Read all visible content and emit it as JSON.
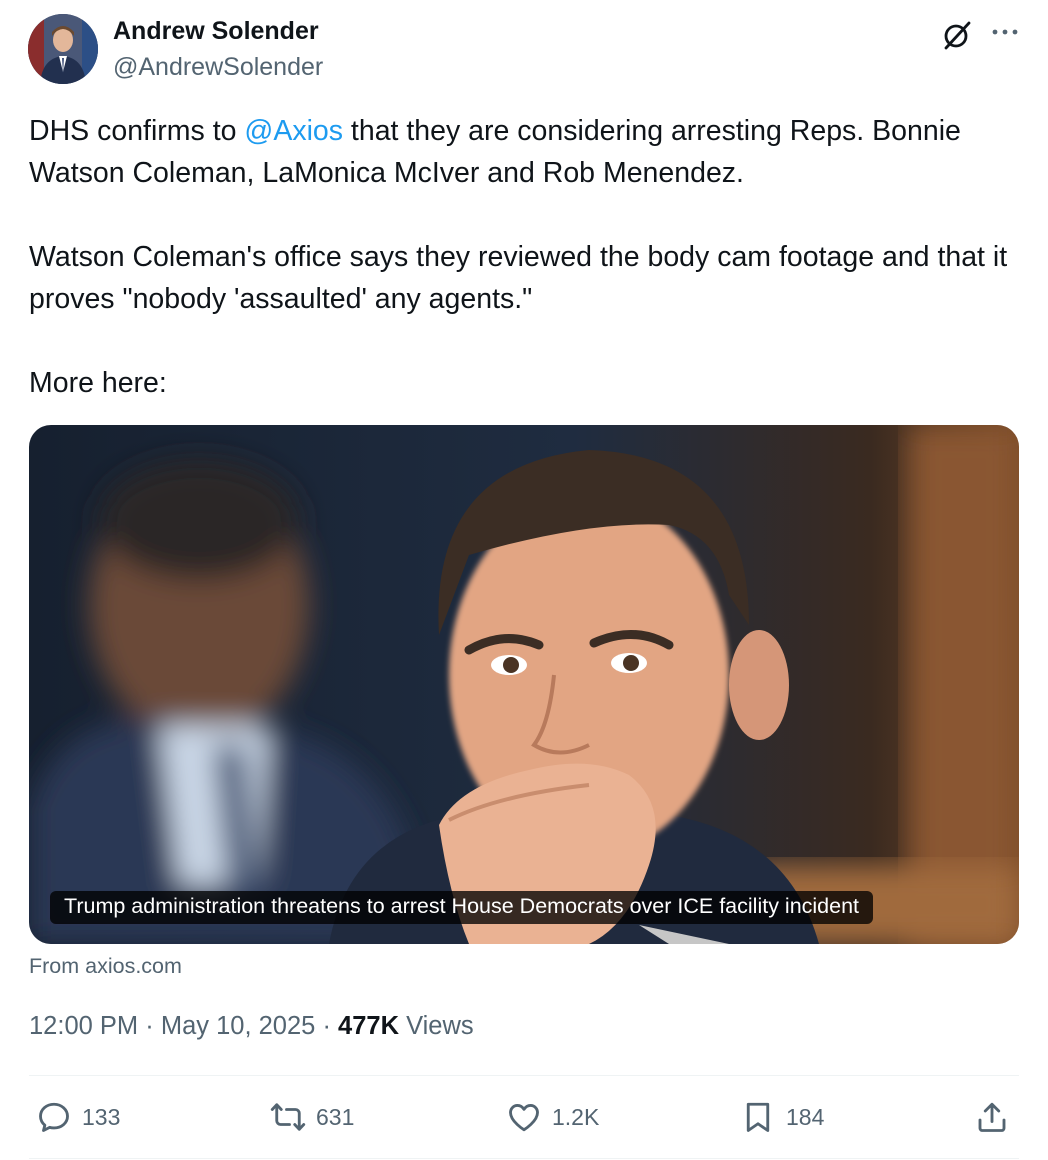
{
  "author": {
    "name": "Andrew Solender",
    "handle": "@AndrewSolender"
  },
  "tweet": {
    "line1_before": "DHS confirms to ",
    "mention": "@Axios",
    "line1_after": " that they are considering arresting Reps. Bonnie Watson Coleman, LaMonica McIver and Rob Menendez.",
    "para2": "Watson Coleman's office says they reviewed the body cam footage and that it proves \"nobody 'assaulted' any agents.\"",
    "para3": "More here:"
  },
  "card": {
    "caption": "Trump administration threatens to arrest House Democrats over ICE facility incident",
    "source": "From axios.com"
  },
  "meta": {
    "time": "12:00 PM",
    "separator": " · ",
    "date": "May 10, 2025",
    "views_count": "477K",
    "views_label": " Views"
  },
  "actions": {
    "replies": "133",
    "reposts": "631",
    "likes": "1.2K",
    "bookmarks": "184"
  },
  "icons": [
    "grok-icon",
    "more-icon",
    "reply-icon",
    "repost-icon",
    "like-icon",
    "bookmark-icon",
    "share-icon"
  ],
  "colors": {
    "link": "#1d9bf0",
    "secondary_text": "#536471",
    "primary_text": "#0f1419"
  }
}
